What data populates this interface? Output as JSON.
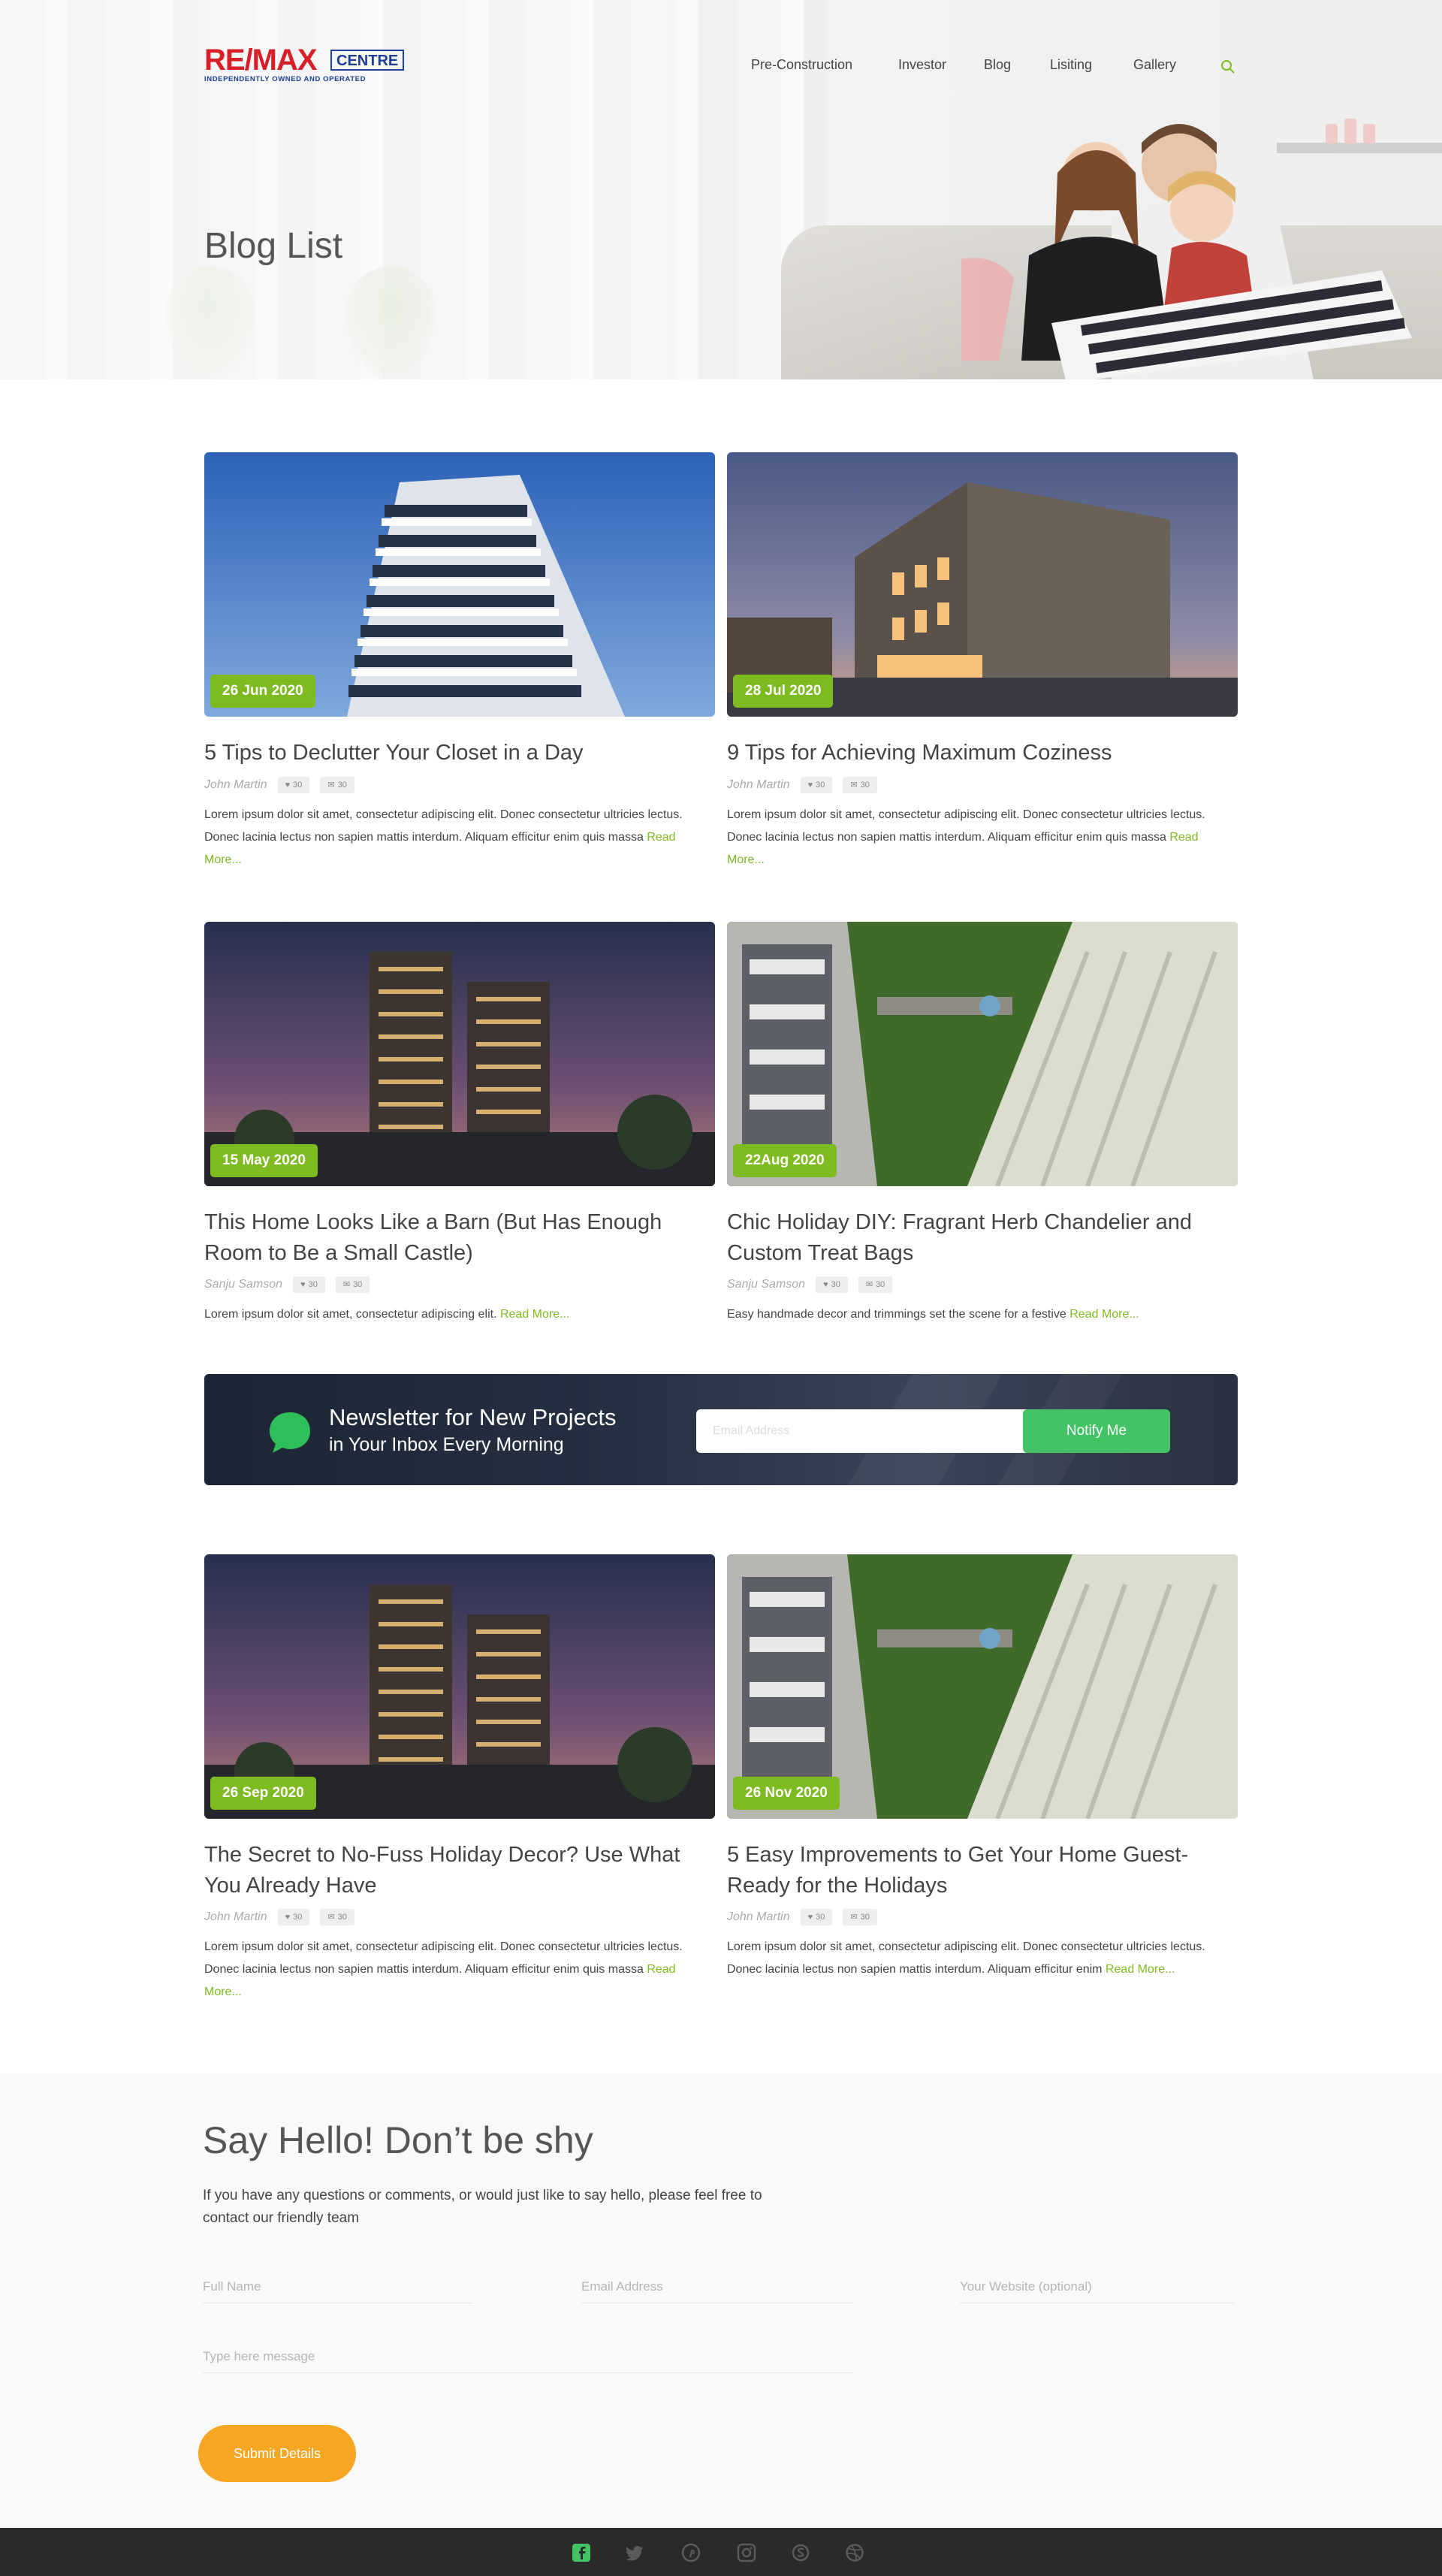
{
  "header": {
    "logo_text": "RE/MAX",
    "logo_centre": "CENTRE",
    "logo_tagline": "INDEPENDENTLY OWNED AND OPERATED",
    "nav": [
      {
        "label": "Pre-Construction"
      },
      {
        "label": "Investor"
      },
      {
        "label": "Blog"
      },
      {
        "label": "Lisiting"
      },
      {
        "label": "Gallery"
      }
    ],
    "search_icon": "search-icon"
  },
  "hero": {
    "title": "Blog List"
  },
  "posts": [
    {
      "date": "26 Jun 2020",
      "title": "5 Tips to Declutter Your Closet in a Day",
      "author": "John Martin",
      "likes": "30",
      "comments": "30",
      "excerpt": "Lorem ipsum dolor sit amet, consectetur adipiscing elit. Donec consectetur ultricies lectus. Donec lacinia lectus non sapien mattis interdum. Aliquam efficitur enim quis massa",
      "read_more": "Read More..."
    },
    {
      "date": "28 Jul 2020",
      "title": "9 Tips for Achieving Maximum Coziness",
      "author": "John Martin",
      "likes": "30",
      "comments": "30",
      "excerpt": "Lorem ipsum dolor sit amet, consectetur adipiscing elit. Donec consectetur ultricies lectus. Donec lacinia lectus non sapien mattis interdum. Aliquam efficitur enim quis massa",
      "read_more": "Read More..."
    },
    {
      "date": "15 May 2020",
      "title": "This Home Looks Like a Barn (But Has Enough Room to Be a Small Castle)",
      "author": "Sanju Samson",
      "likes": "30",
      "comments": "30",
      "excerpt": "Lorem ipsum dolor sit amet, consectetur adipiscing elit.",
      "read_more": "Read More..."
    },
    {
      "date": "22Aug 2020",
      "title": "Chic Holiday DIY: Fragrant Herb Chandelier and Custom Treat Bags",
      "author": "Sanju Samson",
      "likes": "30",
      "comments": "30",
      "excerpt": "Easy handmade decor and trimmings set the scene for a festive",
      "read_more": "Read More..."
    },
    {
      "date": "26 Sep 2020",
      "title": "The Secret to No-Fuss Holiday Decor? Use What You Already Have",
      "author": "John Martin",
      "likes": "30",
      "comments": "30",
      "excerpt": "Lorem ipsum dolor sit amet, consectetur adipiscing elit. Donec consectetur ultricies lectus. Donec lacinia lectus non sapien mattis interdum. Aliquam efficitur enim quis massa",
      "read_more": "Read More..."
    },
    {
      "date": "26 Nov 2020",
      "title": "5 Easy Improvements to Get Your Home Guest-Ready for the Holidays",
      "author": "John Martin",
      "likes": "30",
      "comments": "30",
      "excerpt": "Lorem ipsum dolor sit amet, consectetur adipiscing elit. Donec consectetur ultricies lectus. Donec lacinia lectus non sapien mattis interdum. Aliquam efficitur enim",
      "read_more": "Read More..."
    }
  ],
  "newsletter": {
    "line1": "Newsletter for New Projects",
    "line2": "in Your Inbox Every Morning",
    "placeholder": "Email Address",
    "button": "Notify Me"
  },
  "contact": {
    "title": "Say Hello! Don’t be shy",
    "intro": "If you have any questions or comments, or would just like to say hello, please feel free to contact our friendly team",
    "fields": {
      "name": "Full Name",
      "email": "Email Address",
      "website": "Your Website (optional)",
      "message": "Type here message"
    },
    "submit": "Submit Details"
  },
  "footer": {
    "icons": [
      "facebook-icon",
      "twitter-icon",
      "pinterest-icon",
      "instagram-icon",
      "skype-icon",
      "dribbble-icon"
    ]
  },
  "colors": {
    "accent_green": "#7dbb20",
    "button_green": "#43c366",
    "submit_orange": "#f6a623",
    "brand_red": "#d71f2a",
    "brand_blue": "#1c3f94",
    "footer_bg": "#2a2a2a"
  }
}
